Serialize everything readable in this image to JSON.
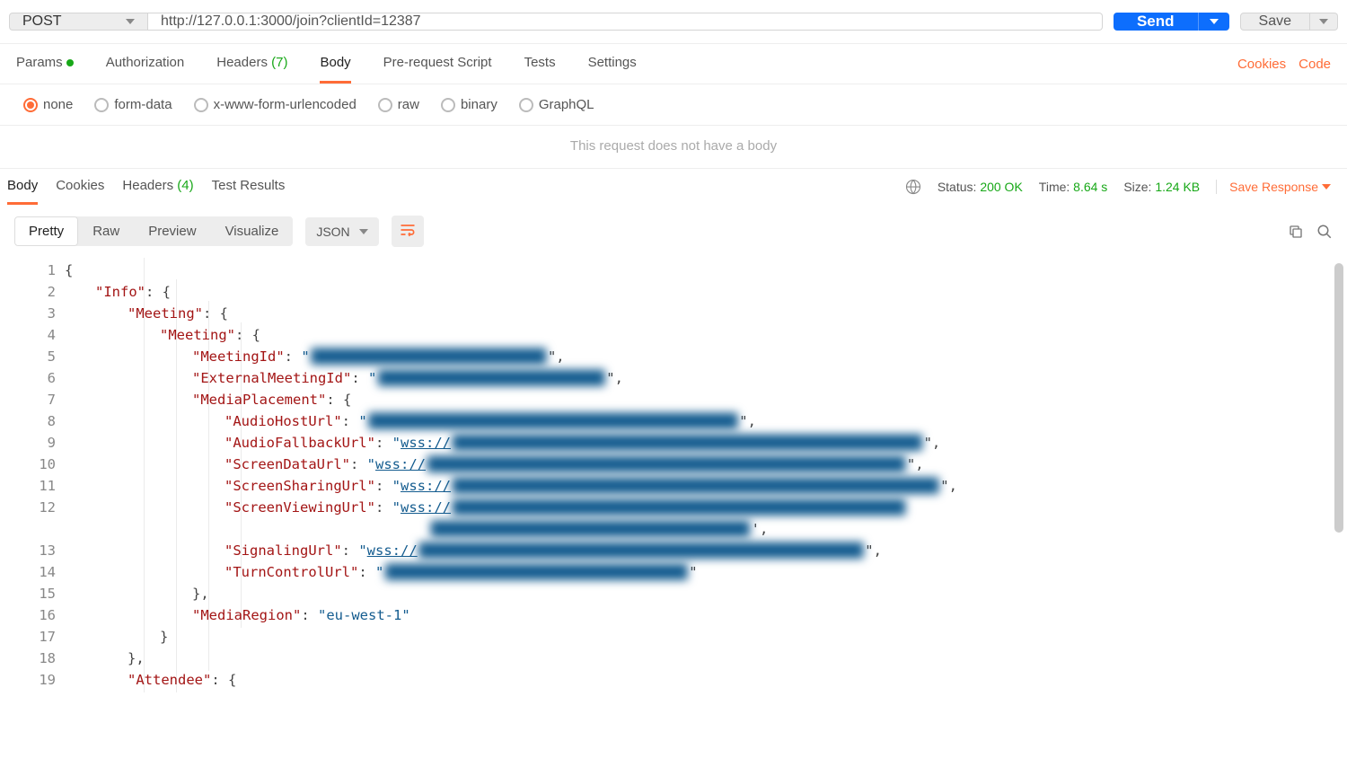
{
  "request": {
    "method": "POST",
    "url": "http://127.0.0.1:3000/join?clientId=12387",
    "send_label": "Send",
    "save_label": "Save"
  },
  "req_tabs": {
    "params": "Params",
    "auth": "Authorization",
    "headers": "Headers",
    "headers_count": "(7)",
    "body": "Body",
    "prereq": "Pre-request Script",
    "tests": "Tests",
    "settings": "Settings"
  },
  "right_links": {
    "cookies": "Cookies",
    "code": "Code"
  },
  "body_types": {
    "none": "none",
    "form": "form-data",
    "urlenc": "x-www-form-urlencoded",
    "raw": "raw",
    "binary": "binary",
    "graphql": "GraphQL"
  },
  "no_body_msg": "This request does not have a body",
  "resp_tabs": {
    "body": "Body",
    "cookies": "Cookies",
    "headers": "Headers",
    "headers_count": "(4)",
    "tests": "Test Results"
  },
  "resp_meta": {
    "status_lbl": "Status:",
    "status_val": "200 OK",
    "time_lbl": "Time:",
    "time_val": "8.64 s",
    "size_lbl": "Size:",
    "size_val": "1.24 KB",
    "save_resp": "Save Response"
  },
  "viewer": {
    "pretty": "Pretty",
    "raw": "Raw",
    "preview": "Preview",
    "visualize": "Visualize",
    "format": "JSON"
  },
  "json_lines": {
    "l1": "{",
    "l2_k": "\"Info\"",
    "l2_r": ": {",
    "l3_k": "\"Meeting\"",
    "l3_r": ": {",
    "l4_k": "\"Meeting\"",
    "l4_r": ": {",
    "l5_k": "\"MeetingId\"",
    "l5_m": ": ",
    "l5_q1": "\"",
    "l5_blur": "████████████████████████████",
    "l5_q2": "\",",
    "l6_k": "\"ExternalMeetingId\"",
    "l6_m": ": ",
    "l6_q1": "\"",
    "l6_blur": "███████████████████████████",
    "l6_q2": "\",",
    "l7_k": "\"MediaPlacement\"",
    "l7_r": ": {",
    "l8_k": "\"AudioHostUrl\"",
    "l8_m": ": ",
    "l8_q1": "\"",
    "l8_blur": "████████████████████████████████████████████",
    "l8_q2": "\",",
    "l9_k": "\"AudioFallbackUrl\"",
    "l9_m": ": ",
    "l9_q1": "\"",
    "l9_v": "wss://",
    "l9_blur": "████████████████████████████████████████████████████████",
    "l9_q2": "\",",
    "l10_k": "\"ScreenDataUrl\"",
    "l10_m": ": ",
    "l10_q1": "\"",
    "l10_v": "wss://",
    "l10_blur": "█████████████████████████████████████████████████████████",
    "l10_q2": "\",",
    "l11_k": "\"ScreenSharingUrl\"",
    "l11_m": ": ",
    "l11_q1": "\"",
    "l11_v": "wss://",
    "l11_blur": "██████████████████████████████████████████████████████████",
    "l11_q2": "\",",
    "l12_k": "\"ScreenViewingUrl\"",
    "l12_m": ": ",
    "l12_q1": "\"",
    "l12_v": "wss://",
    "l12_blur": "██████████████████████████████████████████████████████",
    "l12_blur2": "██████████████████████████████████████",
    "l12_q2": "',",
    "l13_k": "\"SignalingUrl\"",
    "l13_m": ": ",
    "l13_q1": "\"",
    "l13_v": "wss://",
    "l13_blur": "█████████████████████████████████████████████████████",
    "l13_q2": "\",",
    "l14_k": "\"TurnControlUrl\"",
    "l14_m": ": ",
    "l14_q1": "\"",
    "l14_blur": "████████████████████████████████████",
    "l14_q2": "\"",
    "l15": "},",
    "l16_k": "\"MediaRegion\"",
    "l16_m": ": ",
    "l16_v": "\"eu-west-1\"",
    "l17": "}",
    "l18": "},",
    "l19_k": "\"Attendee\"",
    "l19_r": ": {"
  },
  "line_numbers": [
    "1",
    "2",
    "3",
    "4",
    "5",
    "6",
    "7",
    "8",
    "9",
    "10",
    "11",
    "12",
    "",
    "13",
    "14",
    "15",
    "16",
    "17",
    "18",
    "19"
  ]
}
